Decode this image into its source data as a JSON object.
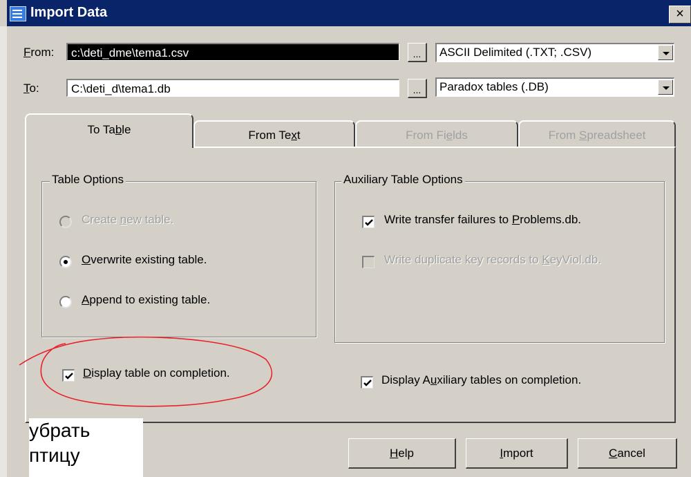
{
  "window": {
    "title": "Import Data",
    "close_glyph": "×"
  },
  "from": {
    "label_pre": "",
    "label_ul": "F",
    "label_post": "rom:",
    "value": "c:\\deti_dme\\tema1.csv",
    "browse": "...",
    "type": "ASCII Delimited (.TXT; .CSV)"
  },
  "to": {
    "label_ul": "T",
    "label_post": "o:",
    "value": "C:\\deti_d\\tema1.db",
    "browse": "...",
    "type": "Paradox tables (.DB)"
  },
  "tabs": [
    {
      "pre": "To Ta",
      "ul": "b",
      "post": "le",
      "state": "active"
    },
    {
      "pre": "From Te",
      "ul": "x",
      "post": "t",
      "state": "enabled"
    },
    {
      "pre": "From Fi",
      "ul": "e",
      "post": "lds",
      "state": "disabled"
    },
    {
      "pre": "From ",
      "ul": "S",
      "post": "preadsheet",
      "state": "disabled"
    }
  ],
  "table_options": {
    "title": "Table Options",
    "create": {
      "pre": "Create ",
      "ul": "n",
      "post": "ew table.",
      "state": "disabled"
    },
    "overwrite": {
      "pre": "",
      "ul": "O",
      "post": "verwrite existing table.",
      "state": "selected"
    },
    "append": {
      "pre": "",
      "ul": "A",
      "post": "ppend to existing table.",
      "state": "unselected"
    }
  },
  "aux_options": {
    "title": "Auxiliary Table Options",
    "write_failures": {
      "pre": "Write transfer failures to ",
      "ul": "P",
      "post": "roblems.db.",
      "checked": true
    },
    "write_dup": {
      "pre": "Write duplicate key records to ",
      "ul": "K",
      "post": "eyViol.db.",
      "checked": false,
      "state": "disabled"
    }
  },
  "display_table": {
    "pre": "",
    "ul": "D",
    "post": "isplay table on completion.",
    "checked": true
  },
  "display_aux": {
    "pre": "Display A",
    "ul": "u",
    "post": "xiliary tables on completion.",
    "checked": true
  },
  "buttons": {
    "help": {
      "ul": "H",
      "post": "elp"
    },
    "import": {
      "ul": "I",
      "post": "mport"
    },
    "cancel": {
      "ul": "C",
      "post": "ancel"
    }
  },
  "annotation": {
    "line1": "убрать",
    "line2": "птицу",
    "circle_color": "#e8202a"
  }
}
